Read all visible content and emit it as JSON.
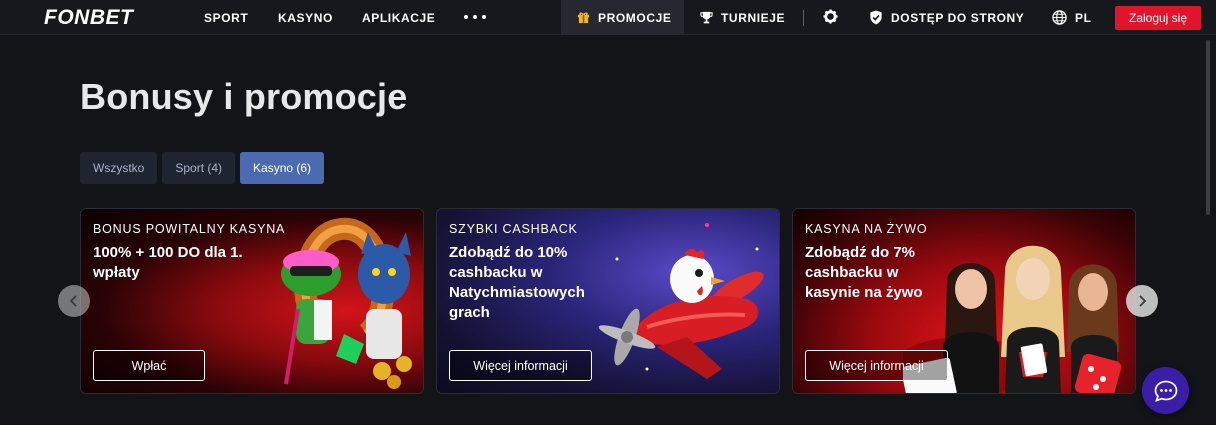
{
  "brand": {
    "logo": "FONBET"
  },
  "nav": {
    "items": [
      {
        "label": "SPORT"
      },
      {
        "label": "KASYNO"
      },
      {
        "label": "APLIKACJE"
      }
    ],
    "promotions": "PROMOCJE",
    "tournaments": "TURNIEJE",
    "site_access": "DOSTĘP DO STRONY",
    "language": "PL",
    "login": "Zaloguj się"
  },
  "page": {
    "title": "Bonusy i promocje",
    "tabs": [
      {
        "label": "Wszystko",
        "active": false
      },
      {
        "label": "Sport (4)",
        "active": false
      },
      {
        "label": "Kasyno (6)",
        "active": true
      }
    ]
  },
  "cards": [
    {
      "eyebrow": "BONUS POWITALNY KASYNA",
      "headline": "100% + 100 DO dla 1. wpłaty",
      "button": "Wpłać"
    },
    {
      "eyebrow": "SZYBKI CASHBACK",
      "headline": "Zdobądź do 10% cashbacku w Natychmiastowych grach",
      "button": "Więcej informacji"
    },
    {
      "eyebrow": "KASYNA NA ŻYWO",
      "headline": "Zdobądź do 7% cashbacku w kasynie na żywo",
      "button": "Więcej informacji"
    }
  ],
  "icons": {
    "promotions": "gift-icon",
    "tournaments": "trophy-icon",
    "settings": "gear-icon",
    "site_access": "shield-check-icon",
    "language": "globe-icon",
    "more": "more-dots-icon",
    "prev": "chevron-left-icon",
    "next": "chevron-right-icon",
    "chat": "chat-bubble-icon"
  },
  "colors": {
    "accent_red": "#e0142a",
    "tab_active": "#4b6ab0",
    "chat": "#3a1ea8"
  }
}
